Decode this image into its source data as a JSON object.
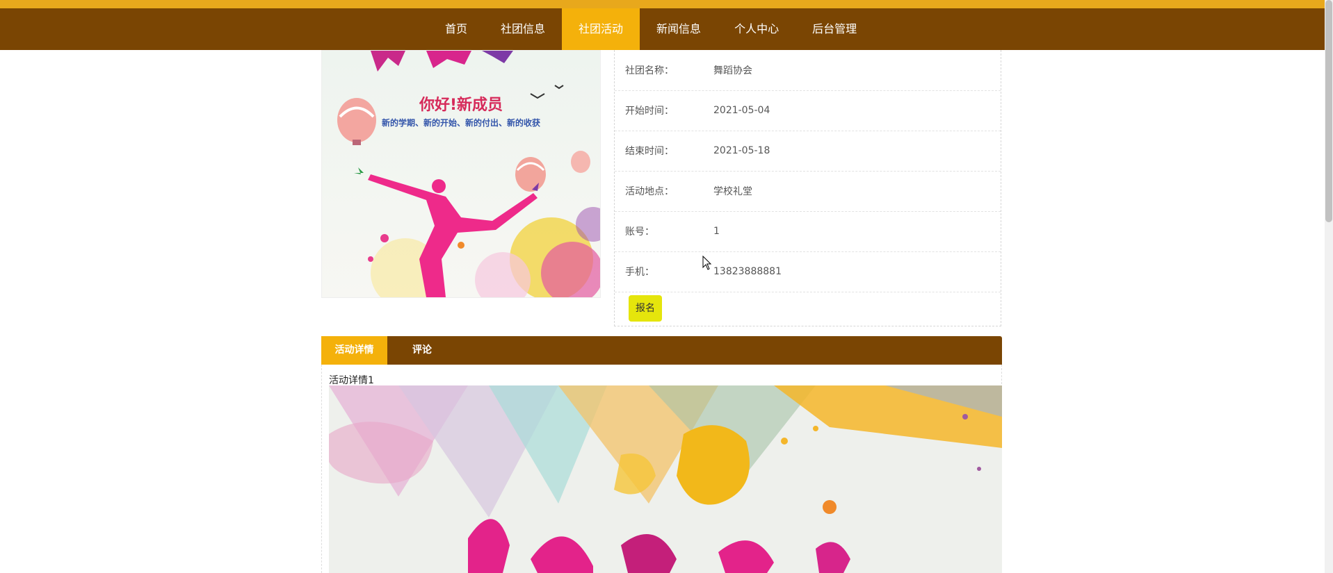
{
  "nav": {
    "items": [
      {
        "label": "首页"
      },
      {
        "label": "社团信息"
      },
      {
        "label": "社团活动",
        "active": true
      },
      {
        "label": "新闻信息"
      },
      {
        "label": "个人中心"
      },
      {
        "label": "后台管理"
      }
    ]
  },
  "poster": {
    "headline": "你好!新成员",
    "subline": "新的学期、新的开始、新的付出、新的收获"
  },
  "info": {
    "rows": [
      {
        "label": "社团名称：",
        "value": "舞蹈协会"
      },
      {
        "label": "开始时间：",
        "value": "2021-05-04"
      },
      {
        "label": "结束时间：",
        "value": "2021-05-18"
      },
      {
        "label": "活动地点：",
        "value": "学校礼堂"
      },
      {
        "label": "账号：",
        "value": "1"
      },
      {
        "label": "手机：",
        "value": "13823888881"
      }
    ],
    "signup_label": "报名"
  },
  "tabs": {
    "items": [
      {
        "label": "活动详情",
        "active": true
      },
      {
        "label": "评论"
      }
    ]
  },
  "detail": {
    "text": "活动详情1"
  },
  "colors": {
    "nav_bg": "#7a4503",
    "accent": "#f4b10b",
    "top_stripe": "#e8a81c",
    "signup_bg": "#e5e50c"
  },
  "icons": {
    "cursor": "mouse-pointer-icon"
  }
}
